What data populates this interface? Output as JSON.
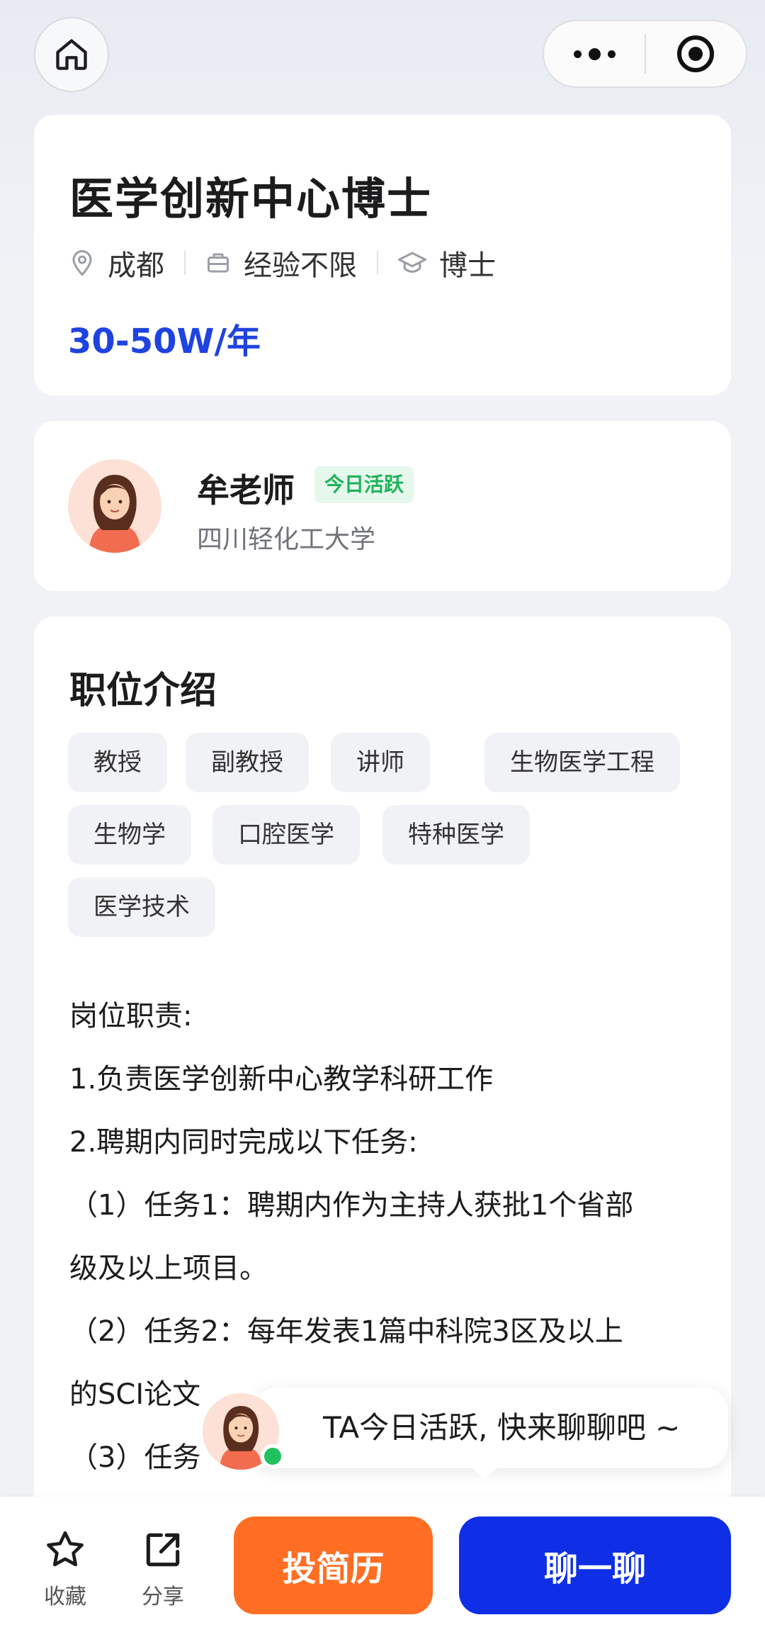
{
  "topbar": {
    "home_icon": "home-icon",
    "more_icon": "more-icon",
    "target_icon": "target-icon"
  },
  "job": {
    "title": "医学创新中心博士",
    "location": "成都",
    "experience": "经验不限",
    "education": "博士",
    "salary": "30-50W/年"
  },
  "recruiter": {
    "name": "牟老师",
    "status": "今日活跃",
    "organization": "四川轻化工大学"
  },
  "description": {
    "title": "职位介绍",
    "tags": [
      "教授",
      "副教授",
      "讲师",
      "生物医学工程",
      "生物学",
      "口腔医学",
      "特种医学",
      "医学技术"
    ],
    "lines": [
      "岗位职责:",
      "1.负责医学创新中心教学科研工作",
      "2.聘期内同时完成以下任务:",
      "（1）任务1：聘期内作为主持人获批1个省部",
      "级及以上项目。",
      "（2）任务2：每年发表1篇中科院3区及以上",
      "的SCI论文",
      "（3）任务"
    ]
  },
  "tip": {
    "text": "TA今日活跃, 快来聊聊吧 ~"
  },
  "bottom_bar": {
    "favorite_label": "收藏",
    "share_label": "分享",
    "resume_button": "投简历",
    "chat_button": "聊一聊"
  },
  "colors": {
    "salary": "#1f43e0",
    "active_badge": "#1fb35a",
    "resume_button": "#ff6e23",
    "chat_button": "#0f2fe6"
  }
}
